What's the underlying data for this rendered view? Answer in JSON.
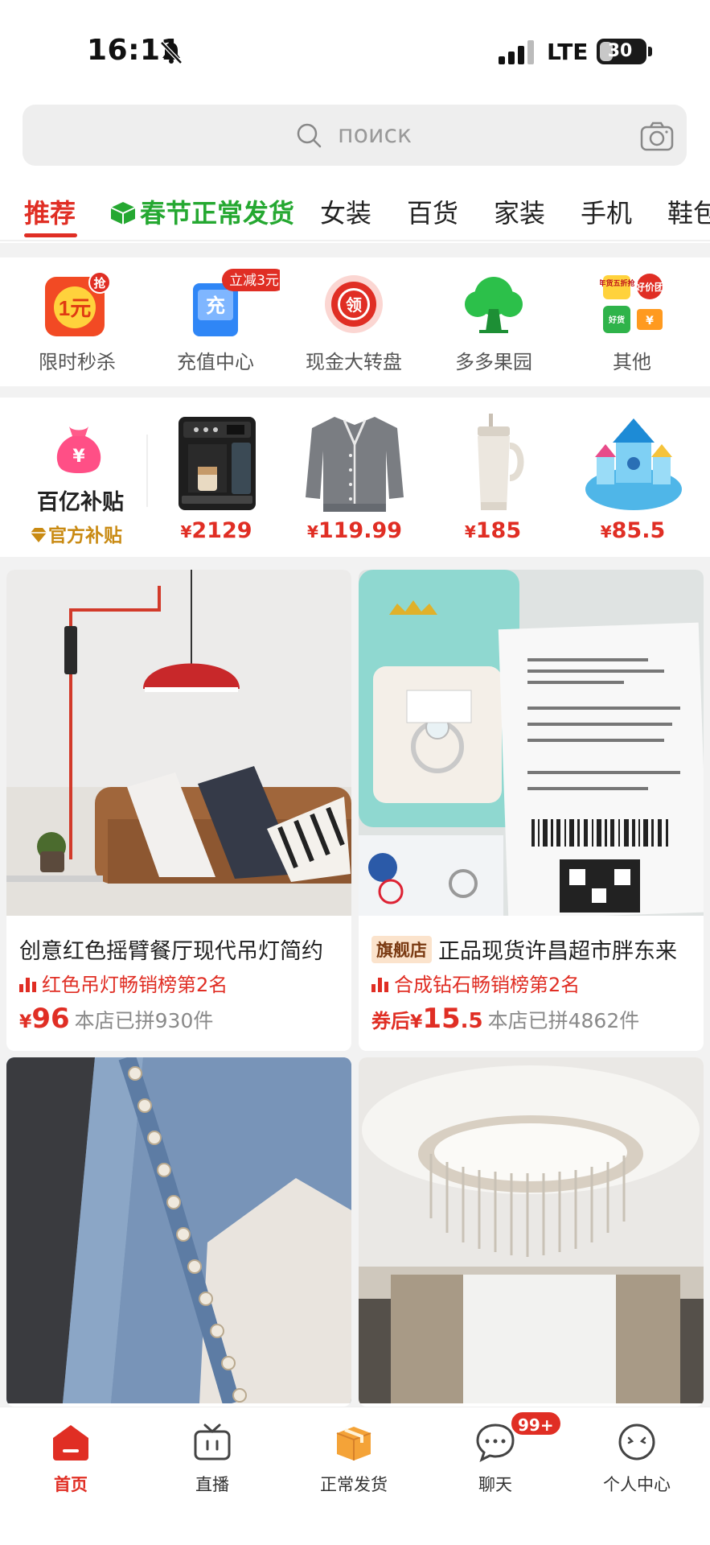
{
  "status_bar": {
    "time": "16:11",
    "network": "LTE",
    "battery": "30",
    "battery_level": 0.3
  },
  "search": {
    "placeholder": "поиск"
  },
  "tabs": [
    "推荐",
    "春节正常发货",
    "女装",
    "百货",
    "家装",
    "手机",
    "鞋包"
  ],
  "shortcuts": [
    {
      "label": "限时秒杀",
      "icon": "flash-sale-icon",
      "badge": "抢",
      "icon_text": "1元"
    },
    {
      "label": "充值中心",
      "icon": "top-up-icon",
      "badge": "立减3元",
      "icon_text": "充"
    },
    {
      "label": "现金大转盘",
      "icon": "prize-wheel-icon",
      "icon_text": "领"
    },
    {
      "label": "多多果园",
      "icon": "orchard-tree-icon"
    },
    {
      "label": "其他",
      "icon": "more-grid-icon",
      "icon_tags": [
        "年货五折抢",
        "好价团",
        "好货",
        "¥"
      ]
    }
  ],
  "subsidy": {
    "title": "百亿补贴",
    "subtitle": "官方补贴",
    "bag_symbol": "¥",
    "items": [
      {
        "name": "espresso-machine",
        "price": "2129"
      },
      {
        "name": "gray-cardigan",
        "price": "119.99"
      },
      {
        "name": "tumbler-cup",
        "price": "185"
      },
      {
        "name": "toy-castle",
        "price": "85.5"
      }
    ]
  },
  "currency": "¥",
  "feed": [
    {
      "title": "创意红色摇臂餐厅现代吊灯简约",
      "rank": "红色吊灯畅销榜第2名",
      "price_prefix": "",
      "price_int": "96",
      "price_dec": "",
      "sold": "本店已拼930件",
      "badge": ""
    },
    {
      "title": "正品现货许昌超市胖东来",
      "rank": "合成钻石畅销榜第2名",
      "price_prefix": "券后",
      "price_int": "15",
      "price_dec": ".5",
      "sold": "本店已拼4862件",
      "badge": "旗舰店"
    },
    {
      "title": "",
      "image": "denim-cardigan"
    },
    {
      "title": "",
      "image": "crystal-chandelier"
    }
  ],
  "bottom_nav": [
    {
      "label": "首页",
      "icon": "home-icon",
      "active": true
    },
    {
      "label": "直播",
      "icon": "live-tv-icon"
    },
    {
      "label": "正常发货",
      "icon": "package-box-icon"
    },
    {
      "label": "聊天",
      "icon": "chat-bubble-icon",
      "badge": "99+"
    },
    {
      "label": "个人中心",
      "icon": "profile-face-icon"
    }
  ],
  "colors": {
    "brand_red": "#e02e24",
    "promo_green": "#25a831",
    "gold": "#c98a12"
  }
}
